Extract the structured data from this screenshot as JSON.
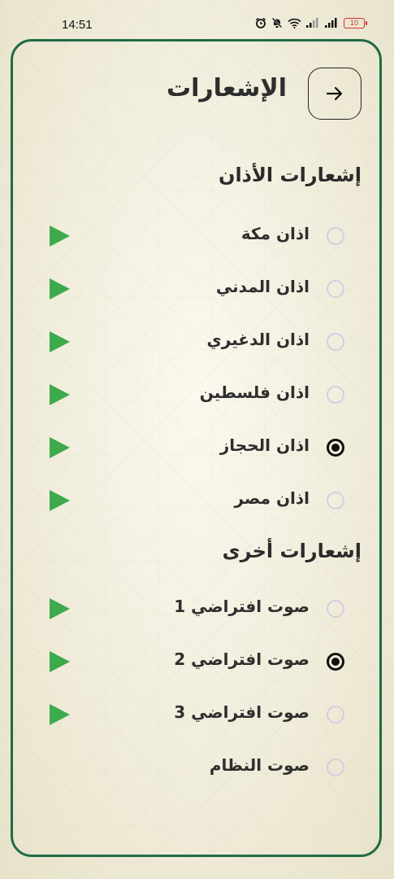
{
  "status_bar": {
    "time": "14:51",
    "battery": "10",
    "icons": [
      "alarm-icon",
      "mute-icon",
      "wifi-icon",
      "signal-icon",
      "signal-icon",
      "battery-icon"
    ]
  },
  "header": {
    "title": "الإشعارات",
    "back_icon": "arrow-right-icon"
  },
  "sections": [
    {
      "title": "إشعارات الأذان",
      "options": [
        {
          "label": "اذان مكة",
          "selected": false,
          "play_icon": "play-icon"
        },
        {
          "label": "اذان المدني",
          "selected": false,
          "play_icon": "play-icon"
        },
        {
          "label": "اذان الدغيري",
          "selected": false,
          "play_icon": "play-icon"
        },
        {
          "label": "اذان فلسطين",
          "selected": false,
          "play_icon": "play-icon"
        },
        {
          "label": "اذان الحجاز",
          "selected": true,
          "play_icon": "play-icon"
        },
        {
          "label": "اذان مصر",
          "selected": false,
          "play_icon": "play-icon"
        }
      ]
    },
    {
      "title": "إشعارات أخرى",
      "options": [
        {
          "label": "صوت افتراضي 1",
          "selected": false,
          "play_icon": "play-icon"
        },
        {
          "label": "صوت افتراضي 2",
          "selected": true,
          "play_icon": "play-icon"
        },
        {
          "label": "صوت افتراضي 3",
          "selected": false,
          "play_icon": "play-icon"
        },
        {
          "label": "صوت النظام",
          "selected": false
        }
      ]
    }
  ],
  "colors": {
    "frame_border": "#1f6b47",
    "play_green": "#3daa4b",
    "radio_unselected": "#d5cde0",
    "radio_selected": "#111111",
    "battery_low": "#d62d2d"
  }
}
